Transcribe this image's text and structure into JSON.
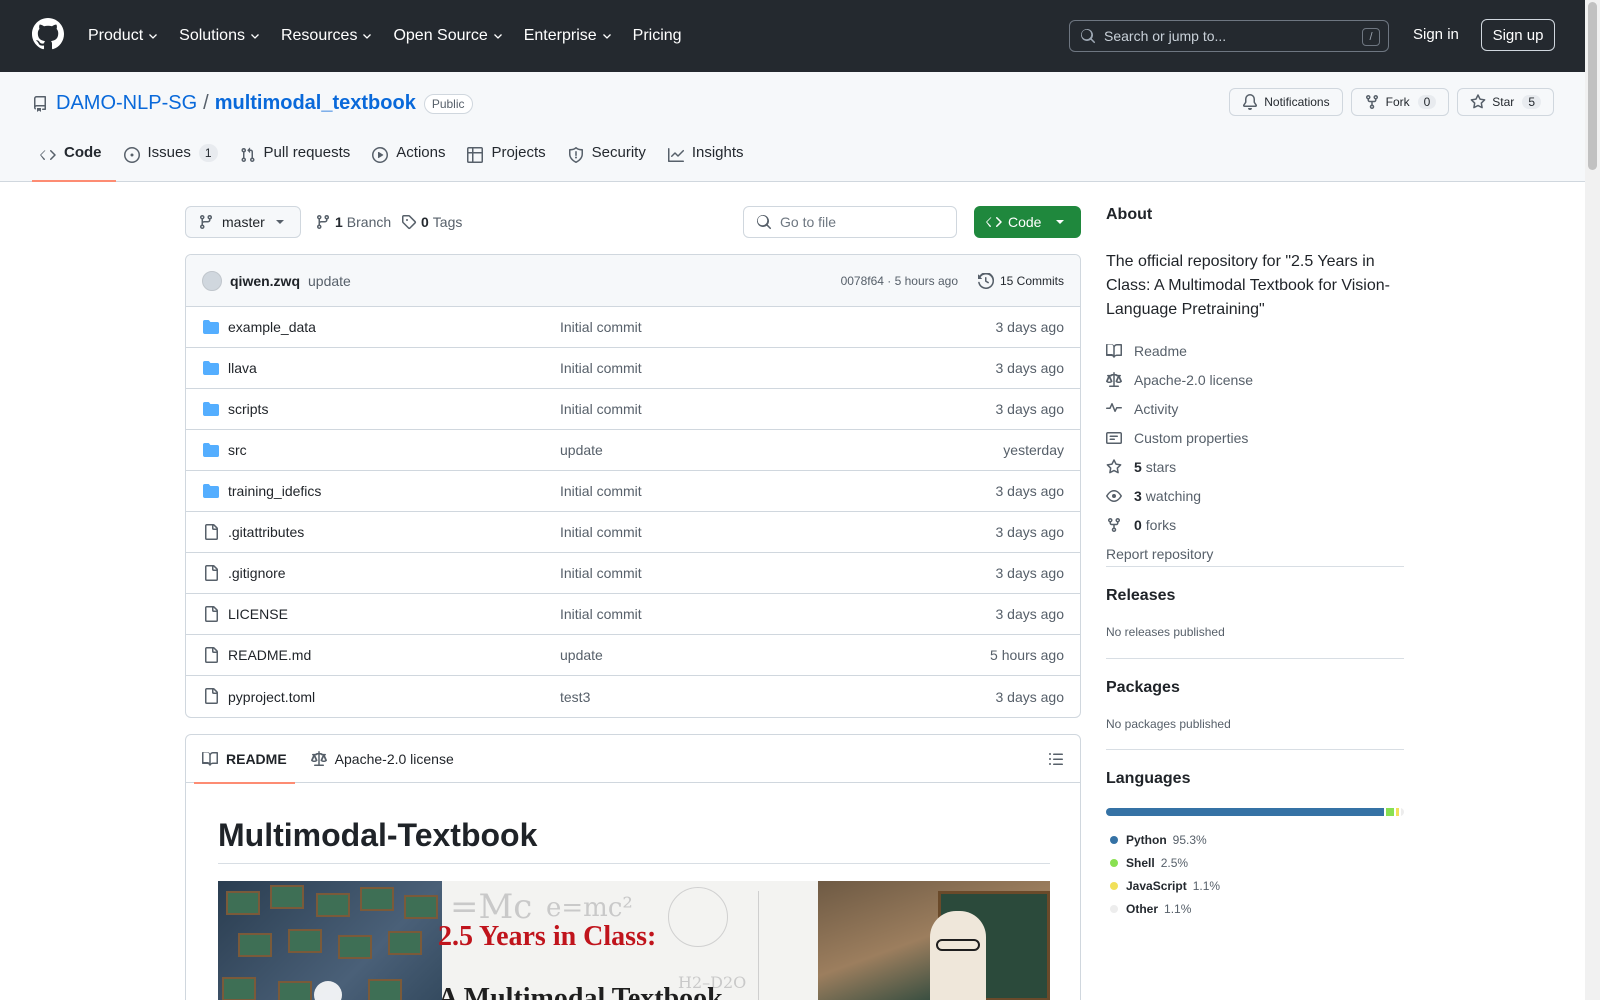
{
  "header": {
    "nav": [
      {
        "label": "Product",
        "has_caret": true
      },
      {
        "label": "Solutions",
        "has_caret": true
      },
      {
        "label": "Resources",
        "has_caret": true
      },
      {
        "label": "Open Source",
        "has_caret": true
      },
      {
        "label": "Enterprise",
        "has_caret": true
      },
      {
        "label": "Pricing",
        "has_caret": false
      }
    ],
    "search_placeholder": "Search or jump to...",
    "search_shortcut": "/",
    "sign_in": "Sign in",
    "sign_up": "Sign up"
  },
  "repo": {
    "owner": "DAMO-NLP-SG",
    "separator": "/",
    "name": "multimodal_textbook",
    "visibility": "Public",
    "actions": {
      "notifications": "Notifications",
      "fork": "Fork",
      "fork_count": "0",
      "star": "Star",
      "star_count": "5"
    },
    "tabs": [
      {
        "label": "Code",
        "icon": "code-icon",
        "active": true,
        "count": ""
      },
      {
        "label": "Issues",
        "icon": "issue-opened-icon",
        "active": false,
        "count": "1"
      },
      {
        "label": "Pull requests",
        "icon": "pull-request-icon",
        "active": false,
        "count": ""
      },
      {
        "label": "Actions",
        "icon": "play-icon",
        "active": false,
        "count": ""
      },
      {
        "label": "Projects",
        "icon": "table-icon",
        "active": false,
        "count": ""
      },
      {
        "label": "Security",
        "icon": "shield-icon",
        "active": false,
        "count": ""
      },
      {
        "label": "Insights",
        "icon": "graph-icon",
        "active": false,
        "count": ""
      }
    ]
  },
  "toolbar": {
    "branch": "master",
    "branch_count": "1",
    "branch_label": "Branch",
    "tag_count": "0",
    "tag_label": "Tags",
    "goto_placeholder": "Go to file",
    "code_button": "Code"
  },
  "commit": {
    "author": "qiwen.zwq",
    "message": "update",
    "meta": "0078f64 · 5 hours ago",
    "count_label": "15 Commits"
  },
  "files": [
    {
      "name": "example_data",
      "type": "folder",
      "message": "Initial commit",
      "time": "3 days ago"
    },
    {
      "name": "llava",
      "type": "folder",
      "message": "Initial commit",
      "time": "3 days ago"
    },
    {
      "name": "scripts",
      "type": "folder",
      "message": "Initial commit",
      "time": "3 days ago"
    },
    {
      "name": "src",
      "type": "folder",
      "message": "update",
      "time": "yesterday"
    },
    {
      "name": "training_idefics",
      "type": "folder",
      "message": "Initial commit",
      "time": "3 days ago"
    },
    {
      "name": ".gitattributes",
      "type": "file",
      "message": "Initial commit",
      "time": "3 days ago"
    },
    {
      "name": ".gitignore",
      "type": "file",
      "message": "Initial commit",
      "time": "3 days ago"
    },
    {
      "name": "LICENSE",
      "type": "file",
      "message": "Initial commit",
      "time": "3 days ago"
    },
    {
      "name": "README.md",
      "type": "file",
      "message": "update",
      "time": "5 hours ago"
    },
    {
      "name": "pyproject.toml",
      "type": "file",
      "message": "test3",
      "time": "3 days ago"
    }
  ],
  "readme": {
    "tab_readme": "README",
    "tab_license": "Apache-2.0 license",
    "heading": "Multimodal-Textbook",
    "banner_title": "2.5 Years in Class:",
    "banner_subtitle": "A Multimodal Textbook"
  },
  "about": {
    "title": "About",
    "description": "The official repository for \"2.5 Years in Class: A Multimodal Textbook for Vision-Language Pretraining\"",
    "items": [
      {
        "icon": "book-icon",
        "strong": "",
        "label": "Readme"
      },
      {
        "icon": "law-icon",
        "strong": "",
        "label": "Apache-2.0 license"
      },
      {
        "icon": "pulse-icon",
        "strong": "",
        "label": "Activity"
      },
      {
        "icon": "note-icon",
        "strong": "",
        "label": "Custom properties"
      },
      {
        "icon": "star-icon",
        "strong": "5",
        "label": "stars"
      },
      {
        "icon": "eye-icon",
        "strong": "3",
        "label": "watching"
      },
      {
        "icon": "fork-icon",
        "strong": "0",
        "label": "forks"
      }
    ],
    "report": "Report repository"
  },
  "releases": {
    "title": "Releases",
    "empty": "No releases published"
  },
  "packages": {
    "title": "Packages",
    "empty": "No packages published"
  },
  "languages": {
    "title": "Languages",
    "items": [
      {
        "name": "Python",
        "percent": "95.3%",
        "value": 95.3,
        "color": "#3572A5"
      },
      {
        "name": "Shell",
        "percent": "2.5%",
        "value": 2.5,
        "color": "#89e051"
      },
      {
        "name": "JavaScript",
        "percent": "1.1%",
        "value": 1.1,
        "color": "#f1e05a"
      },
      {
        "name": "Other",
        "percent": "1.1%",
        "value": 1.1,
        "color": "#ededed"
      }
    ]
  }
}
